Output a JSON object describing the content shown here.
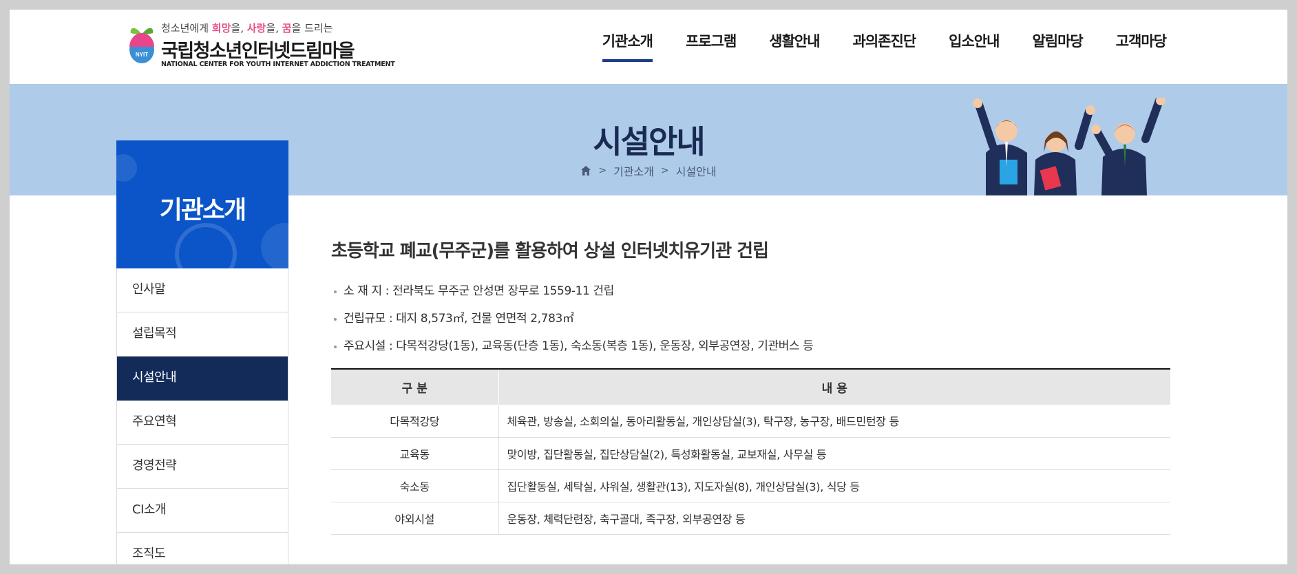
{
  "header": {
    "tagline_parts": [
      "청소년에게 ",
      "희망",
      "을, ",
      "사랑",
      "을, ",
      "꿈",
      "을 드리는"
    ],
    "logo_badge": "NYIT",
    "org_name": "국립청소년인터넷드림마을",
    "org_name_en": "NATIONAL CENTER FOR YOUTH INTERNET ADDICTION TREATMENT",
    "nav": [
      {
        "label": "기관소개",
        "active": true
      },
      {
        "label": "프로그램",
        "active": false
      },
      {
        "label": "생활안내",
        "active": false
      },
      {
        "label": "과의존진단",
        "active": false
      },
      {
        "label": "입소안내",
        "active": false
      },
      {
        "label": "알림마당",
        "active": false
      },
      {
        "label": "고객마당",
        "active": false
      }
    ]
  },
  "banner": {
    "title": "시설안내",
    "breadcrumb": [
      "기관소개",
      "시설안내"
    ]
  },
  "sidebar": {
    "title": "기관소개",
    "items": [
      {
        "label": "인사말",
        "active": false
      },
      {
        "label": "설립목적",
        "active": false
      },
      {
        "label": "시설안내",
        "active": true
      },
      {
        "label": "주요연혁",
        "active": false
      },
      {
        "label": "경영전략",
        "active": false
      },
      {
        "label": "CI소개",
        "active": false
      },
      {
        "label": "조직도",
        "active": false
      }
    ]
  },
  "main": {
    "heading": "초등학교 폐교(무주군)를 활용하여 상설 인터넷치유기관 건립",
    "info": [
      "소 재 지 : 전라북도 무주군 안성면 장무로 1559-11 건립",
      "건립규모 : 대지 8,573㎡, 건물 연면적 2,783㎡",
      "주요시설 : 다목적강당(1동), 교육동(단층 1동), 숙소동(복층 1동), 운동장, 외부공연장, 기관버스 등"
    ],
    "table": {
      "headers": [
        "구 분",
        "내 용"
      ],
      "rows": [
        [
          "다목적강당",
          "체육관, 방송실, 소회의실, 동아리활동실, 개인상담실(3), 탁구장, 농구장, 배드민턴장 등"
        ],
        [
          "교육동",
          "맞이방, 집단활동실, 집단상담실(2), 특성화활동실, 교보재실, 사무실 등"
        ],
        [
          "숙소동",
          "집단활동실, 세탁실, 샤워실, 생활관(13), 지도자실(8), 개인상담실(3), 식당 등"
        ],
        [
          "야외시설",
          "운동장, 체력단련장, 축구골대, 족구장, 외부공연장 등"
        ]
      ]
    }
  },
  "colors": {
    "nav_active_bar": "#1d3b8b",
    "banner_bg": "#aecbea",
    "side_head_bg": "#0b55c9",
    "side_active_bg": "#132b59",
    "tagline_highlight": "#e84d8a"
  }
}
